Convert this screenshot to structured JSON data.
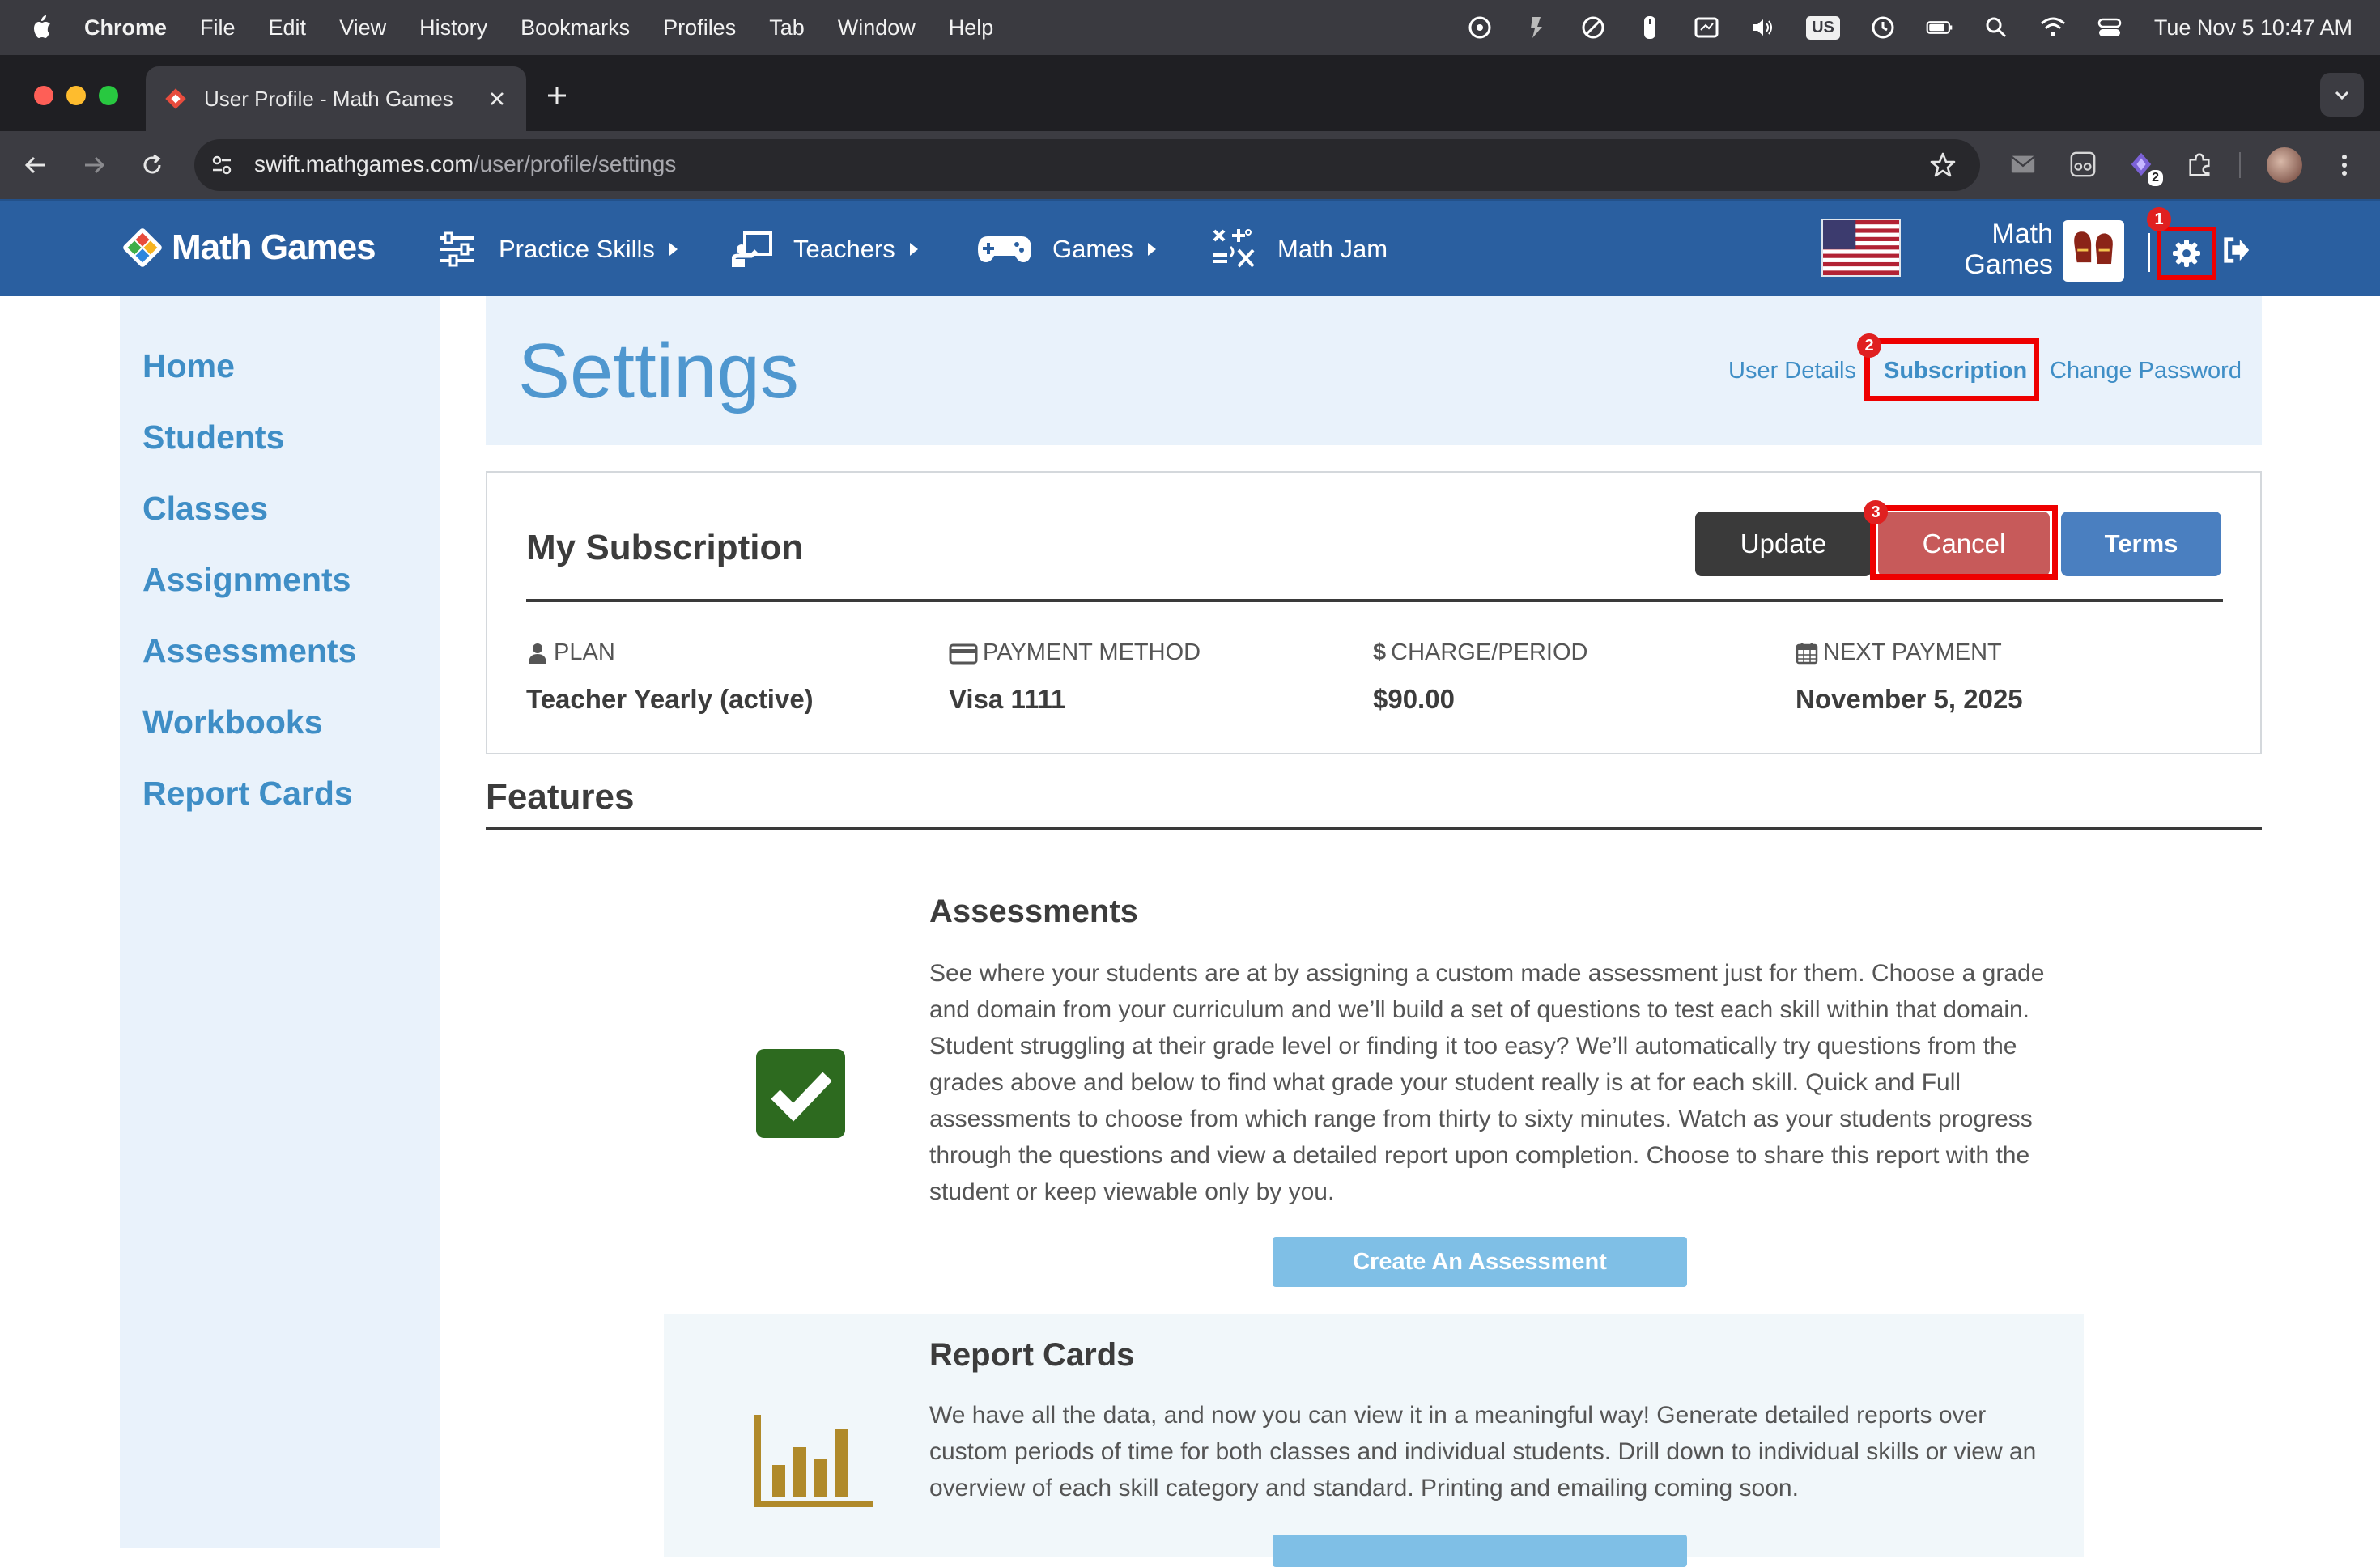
{
  "menubar": {
    "app": "Chrome",
    "items": [
      "File",
      "Edit",
      "View",
      "History",
      "Bookmarks",
      "Profiles",
      "Tab",
      "Window",
      "Help"
    ],
    "keyboard": "US",
    "datetime": "Tue Nov 5  10:47 AM"
  },
  "browser": {
    "tab_title": "User Profile - Math Games",
    "url_host": "swift.mathgames.com",
    "url_path": "/user/profile/settings",
    "extension_badge": "2"
  },
  "site": {
    "logo": "Math Games",
    "nav": [
      {
        "label": "Practice Skills"
      },
      {
        "label": "Teachers"
      },
      {
        "label": "Games"
      },
      {
        "label": "Math Jam"
      }
    ],
    "brand_line1": "Math",
    "brand_line2": "Games"
  },
  "sidebar": {
    "items": [
      {
        "label": "Home"
      },
      {
        "label": "Students"
      },
      {
        "label": "Classes"
      },
      {
        "label": "Assignments"
      },
      {
        "label": "Assessments"
      },
      {
        "label": "Workbooks"
      },
      {
        "label": "Report Cards"
      }
    ]
  },
  "settings": {
    "title": "Settings",
    "tabs": [
      {
        "label": "User Details"
      },
      {
        "label": "Subscription"
      },
      {
        "label": "Change Password"
      }
    ]
  },
  "subscription": {
    "title": "My Subscription",
    "update_label": "Update",
    "cancel_label": "Cancel",
    "terms_label": "Terms",
    "plan_label": "PLAN",
    "plan_value": "Teacher Yearly (active)",
    "payment_label": "PAYMENT METHOD",
    "payment_value": "Visa 1111",
    "charge_label": "CHARGE/PERIOD",
    "charge_value": "$90.00",
    "next_label": "NEXT PAYMENT",
    "next_value": "November 5, 2025"
  },
  "features": {
    "title": "Features",
    "items": [
      {
        "title": "Assessments",
        "description": "See where your students are at by assigning a custom made assessment just for them. Choose a grade and domain from your curriculum and we’ll build a set of questions to test each skill within that domain. Student struggling at their grade level or finding it too easy? We’ll automatically try questions from the grades above and below to find what grade your student really is at for each skill. Quick and Full assessments to choose from which range from thirty to sixty minutes. Watch as your students progress through the questions and view a detailed report upon completion. Choose to share this report with the student or keep viewable only by you.",
        "button": "Create An Assessment"
      },
      {
        "title": "Report Cards",
        "description": "We have all the data, and now you can view it in a meaningful way! Generate detailed reports over custom periods of time for both classes and individual students. Drill down to individual skills or view an overview of each skill category and standard. Printing and emailing coming soon."
      }
    ]
  },
  "annotations": [
    "1",
    "2",
    "3"
  ],
  "colors": {
    "nav_bg": "#2a5fa0",
    "sidebar_bg": "#e9f2fb",
    "link": "#3f8ec6",
    "highlight": "#ee0000",
    "check_green": "#2d6a1f",
    "chart_gold": "#b08a2a"
  },
  "icons": [
    "apple-icon",
    "gear-icon",
    "logout-icon",
    "check-icon",
    "bar-chart-icon",
    "user-icon",
    "credit-card-icon",
    "dollar-icon",
    "calendar-icon",
    "sliders-icon",
    "teacher-icon",
    "gamepad-icon",
    "math-jam-icon",
    "us-flag-icon"
  ]
}
